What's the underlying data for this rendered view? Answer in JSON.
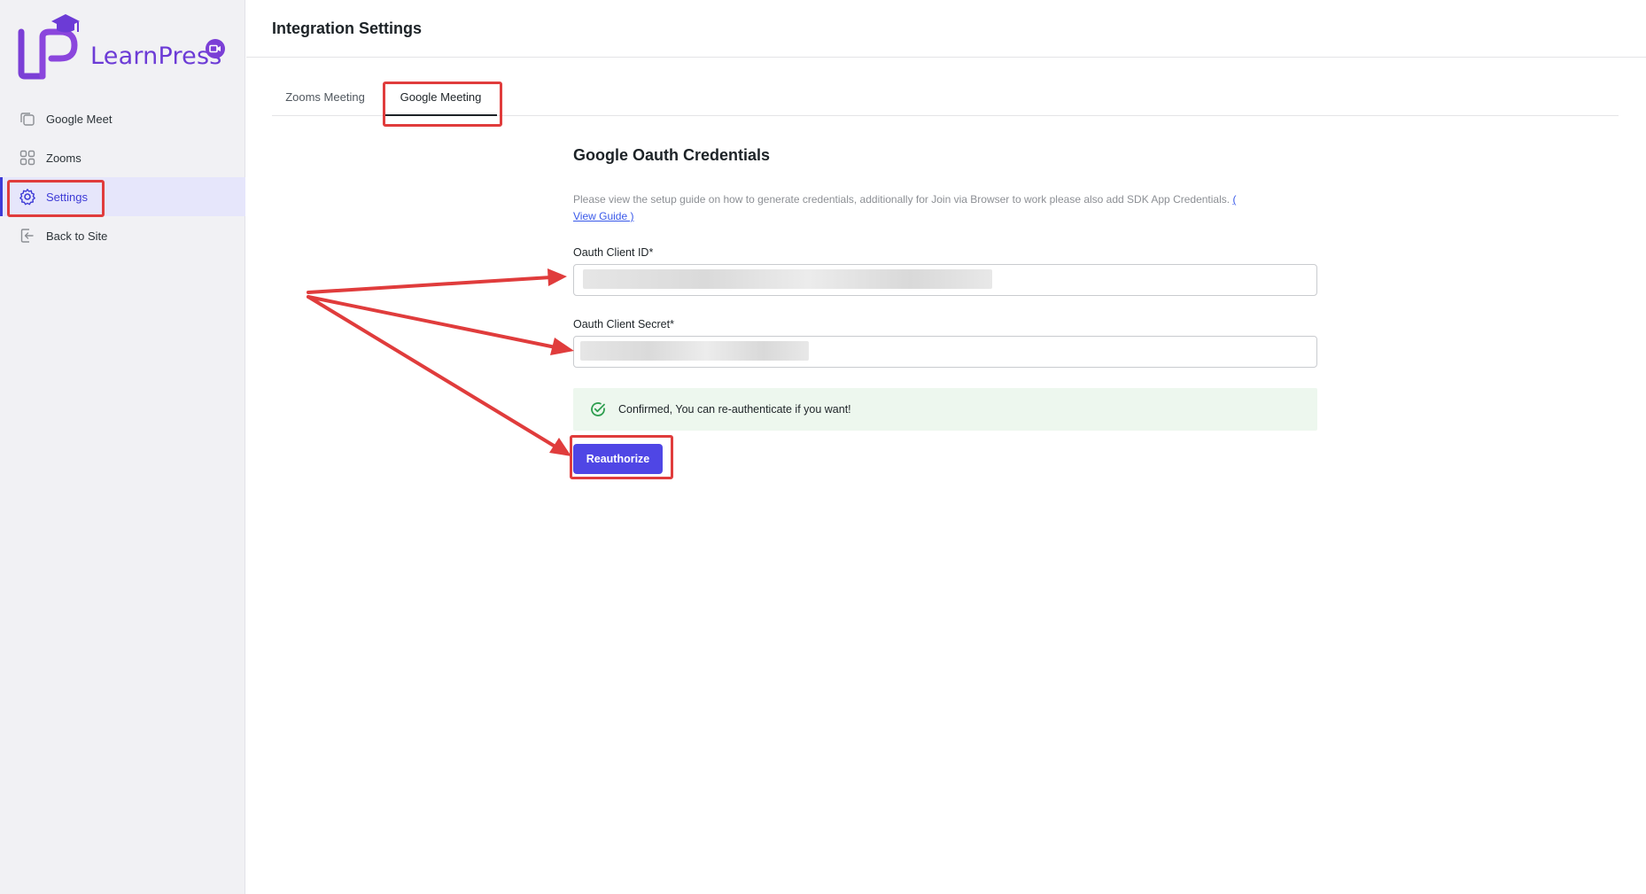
{
  "app": {
    "brand": "LearnPress",
    "brand_color": "#6c3bd6",
    "accent_color": "#4f46e5",
    "annotation_color": "#e03c3c"
  },
  "sidebar": {
    "items": [
      {
        "label": "Google Meet",
        "icon": "copy-icon"
      },
      {
        "label": "Zooms",
        "icon": "grid-icon"
      },
      {
        "label": "Settings",
        "icon": "gear-icon",
        "active": true
      },
      {
        "label": "Back to Site",
        "icon": "exit-icon"
      }
    ]
  },
  "header": {
    "title": "Integration Settings"
  },
  "tabs": [
    {
      "label": "Zooms Meeting"
    },
    {
      "label": "Google Meeting",
      "active": true
    }
  ],
  "main": {
    "section_title": "Google Oauth Credentials",
    "description": "Please view the setup guide on how to generate credentials, additionally for Join via Browser to work please also add SDK App Credentials.",
    "guide_link_open": "(",
    "guide_link_text": "View Guide )",
    "client_id_label": "Oauth Client ID*",
    "client_secret_label": "Oauth Client Secret*",
    "notice_text": "Confirmed, You can re-authenticate if you want!",
    "reauthorize_label": "Reauthorize"
  }
}
